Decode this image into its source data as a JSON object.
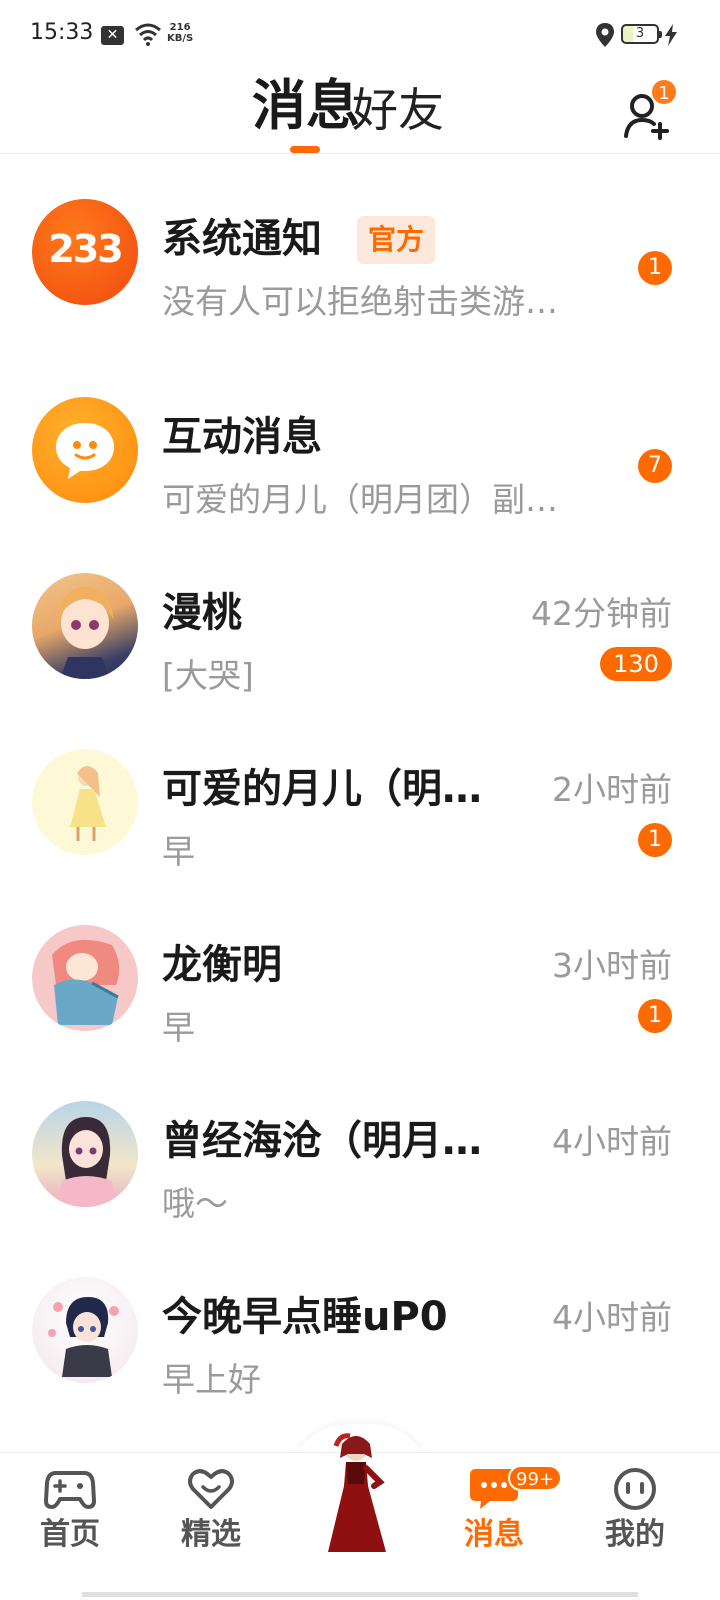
{
  "status_bar": {
    "time": "15:33",
    "net_speed_value": "216",
    "net_speed_unit": "KB/S",
    "battery_level": "3"
  },
  "header": {
    "tabs": [
      {
        "label": "消息",
        "active": true
      },
      {
        "label": "好友",
        "active": false
      }
    ],
    "add_friend_badge": "1"
  },
  "conversations": [
    {
      "name": "系统通知",
      "tag": "官方",
      "preview": "没有人可以拒绝射击类游…",
      "time": "",
      "badge": "1",
      "avatar": "logo-233"
    },
    {
      "name": "互动消息",
      "tag": "",
      "preview": "可爱的月儿（明月团）副…",
      "time": "",
      "badge": "7",
      "avatar": "chat-bubble-logo"
    },
    {
      "name": "漫桃",
      "tag": "",
      "preview": "[大哭]",
      "time": "42分钟前",
      "badge": "130",
      "avatar": "anime-girl-blonde"
    },
    {
      "name": "可爱的月儿（明…",
      "tag": "",
      "preview": "早",
      "time": "2小时前",
      "badge": "1",
      "avatar": "anime-girl-dress"
    },
    {
      "name": "龙衡明",
      "tag": "",
      "preview": "早",
      "time": "3小时前",
      "badge": "1",
      "avatar": "anime-boy-blue"
    },
    {
      "name": "曾经海沧（明月…",
      "tag": "",
      "preview": "哦～",
      "time": "4小时前",
      "badge": "",
      "avatar": "anime-girl-dark-hair"
    },
    {
      "name": "今晚早点睡uP0",
      "tag": "",
      "preview": "早上好",
      "time": "4小时前",
      "badge": "",
      "avatar": "anime-boy-flowers"
    }
  ],
  "avatar_logo_text": "233",
  "bottom_nav": {
    "items": [
      {
        "label": "首页",
        "icon": "gamepad-icon",
        "active": false
      },
      {
        "label": "精选",
        "icon": "heart-icon",
        "active": false
      },
      {
        "label": "消息",
        "icon": "chat-icon",
        "active": true,
        "badge": "99+"
      },
      {
        "label": "我的",
        "icon": "face-icon",
        "active": false
      }
    ]
  },
  "colors": {
    "accent": "#ff6a00",
    "muted_text": "#9a9a9a",
    "official_tag_bg": "#fde9dc"
  }
}
